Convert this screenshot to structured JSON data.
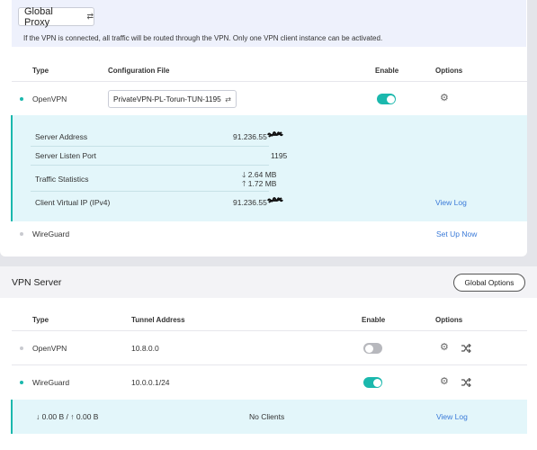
{
  "proxy": {
    "button_label": "Global Proxy",
    "swap_icon": "swap-icon",
    "description": "If the VPN is connected, all traffic will be routed through the VPN. Only one VPN client instance can be activated."
  },
  "client_table": {
    "headers": {
      "type": "Type",
      "config": "Configuration File",
      "enable": "Enable",
      "options": "Options"
    },
    "openvpn": {
      "name": "OpenVPN",
      "config_file": "PrivateVPN-PL-Torun-TUN-1195",
      "enabled": true,
      "status_color": "#1bb8ad"
    },
    "details": {
      "server_address_label": "Server Address",
      "server_address": "91.236.55",
      "listen_port_label": "Server Listen Port",
      "listen_port": "1195",
      "traffic_label": "Traffic Statistics",
      "download": "2.64 MB",
      "upload": "1.72 MB",
      "virtual_ip_label": "Client Virtual IP (IPv4)",
      "virtual_ip": "91.236.55",
      "view_log": "View Log"
    },
    "wireguard": {
      "name": "WireGuard",
      "setup_link": "Set Up Now",
      "status_color": "#c9cad0"
    }
  },
  "vpn_server": {
    "title": "VPN Server",
    "global_options": "Global Options",
    "headers": {
      "type": "Type",
      "tunnel": "Tunnel Address",
      "enable": "Enable",
      "options": "Options"
    },
    "rows": [
      {
        "name": "OpenVPN",
        "tunnel": "10.8.0.0",
        "enabled": false
      },
      {
        "name": "WireGuard",
        "tunnel": "10.0.0.1/24",
        "enabled": true
      }
    ],
    "footer": {
      "traffic": "↓ 0.00 B / ↑ 0.00 B",
      "clients": "No Clients",
      "view_log": "View Log"
    }
  },
  "colors": {
    "accent": "#1bb8ad",
    "link": "#3a7ad8",
    "banner_bg": "#eef1fc",
    "detail_bg": "#e3f6fa"
  }
}
